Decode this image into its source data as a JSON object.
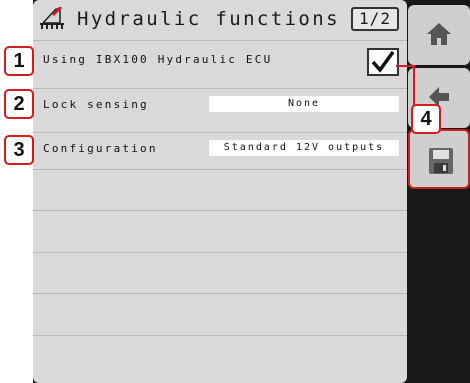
{
  "header": {
    "title": "Hydraulic functions",
    "page_indicator": "1/2",
    "icon": "hydraulic-implement-icon"
  },
  "rows": [
    {
      "label": "Using IBX100 Hydraulic ECU",
      "checked": true
    },
    {
      "label": "Lock sensing",
      "value": "None"
    },
    {
      "label": "Configuration",
      "value": "Standard 12V outputs"
    }
  ],
  "side_buttons": [
    {
      "icon": "home-icon"
    },
    {
      "icon": "back-icon"
    },
    {
      "icon": "save-icon"
    }
  ],
  "callouts": [
    "1",
    "2",
    "3",
    "4"
  ],
  "colors": {
    "callout_border": "#d01e1e",
    "panel_bg": "#d9d9d9",
    "screen_bg": "#171717"
  }
}
